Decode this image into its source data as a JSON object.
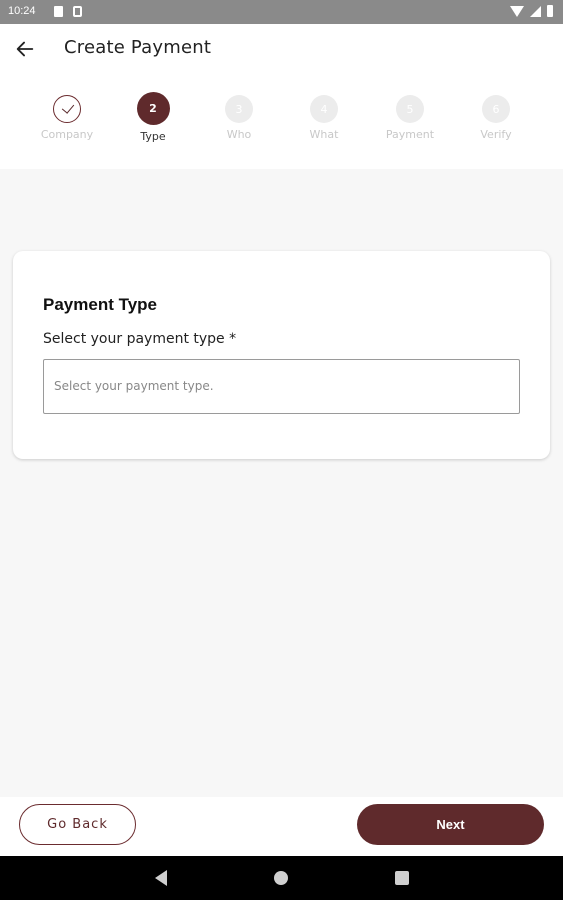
{
  "status_bar": {
    "time": "10:24"
  },
  "app_bar": {
    "title": "Create Payment",
    "back_icon": "arrow-left-icon"
  },
  "stepper": {
    "steps": [
      {
        "number": "",
        "label": "Company",
        "state": "done"
      },
      {
        "number": "2",
        "label": "Type",
        "state": "active"
      },
      {
        "number": "3",
        "label": "Who",
        "state": "pending"
      },
      {
        "number": "4",
        "label": "What",
        "state": "pending"
      },
      {
        "number": "5",
        "label": "Payment",
        "state": "pending"
      },
      {
        "number": "6",
        "label": "Verify",
        "state": "pending"
      }
    ]
  },
  "card": {
    "title": "Payment Type",
    "field_label": "Select your payment type *",
    "select_placeholder": "Select your payment type."
  },
  "buttons": {
    "back": "Go Back",
    "next": "Next"
  },
  "colors": {
    "accent": "#5f2a2c",
    "background": "#f7f7f7"
  }
}
